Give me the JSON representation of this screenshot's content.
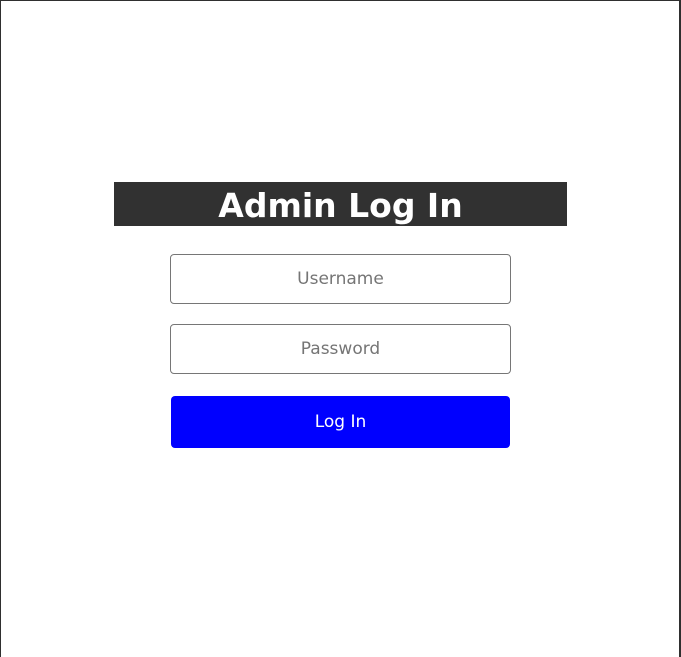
{
  "login_form": {
    "title": "Admin Log In",
    "username": {
      "value": "",
      "placeholder": "Username"
    },
    "password": {
      "value": "",
      "placeholder": "Password"
    },
    "submit_label": "Log In"
  },
  "colors": {
    "banner_background": "#313131",
    "button_background": "#0000ff",
    "button_text": "#ffffff"
  }
}
